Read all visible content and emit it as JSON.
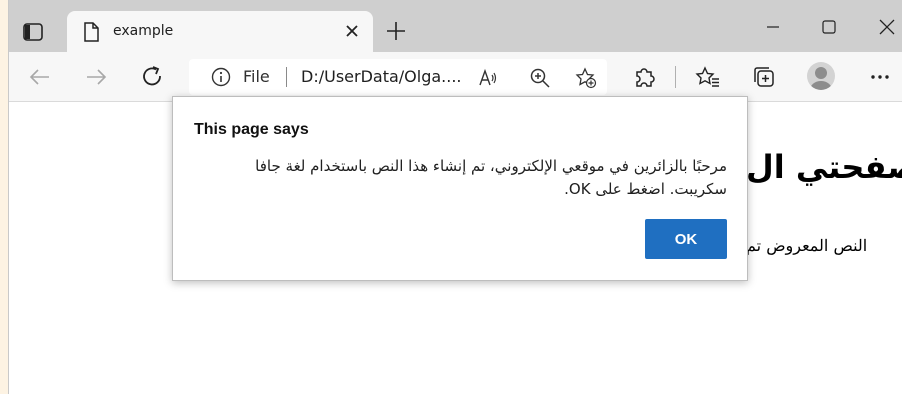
{
  "tab": {
    "title": "example"
  },
  "address_bar": {
    "scheme_label": "File",
    "url": "D:/UserData/Olga...."
  },
  "page": {
    "heading": "صفحتي ال",
    "paragraph": "النص المعروض تم"
  },
  "dialog": {
    "title": "This page says",
    "message_line1": "مرحبًا بالزائرين في موقعي الإلكتروني، تم إنشاء هذا النص باستخدام لغة جافا",
    "message_line2": "سكريبت. اضغط على OK.",
    "ok_label": "OK"
  },
  "colors": {
    "accent": "#1f6fc1",
    "tabbar_bg": "#cfcfcf",
    "toolbar_bg": "#f7f7f7",
    "outer_bg": "#fdf3e3"
  },
  "icons": {
    "tab_actions": "tab-actions-icon",
    "page": "page-icon",
    "close_tab": "close-icon",
    "new_tab": "plus-icon",
    "back": "back-arrow-icon",
    "forward": "forward-arrow-icon",
    "refresh": "refresh-icon",
    "info": "info-icon",
    "read_aloud": "read-aloud-icon",
    "zoom": "zoom-in-icon",
    "add_favorite": "add-favorite-icon",
    "extensions": "extensions-icon",
    "favorites": "favorites-icon",
    "collections": "collections-icon",
    "profile": "profile-icon",
    "more": "more-icon"
  }
}
